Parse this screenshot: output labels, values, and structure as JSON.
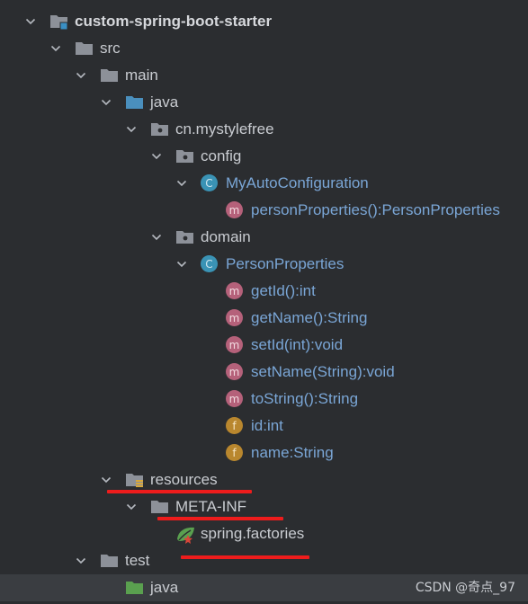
{
  "tree": {
    "nodes": [
      {
        "label": "custom-spring-boot-starter",
        "icon": "module-folder-icon"
      },
      {
        "label": "src",
        "icon": "folder-icon"
      },
      {
        "label": "main",
        "icon": "folder-icon"
      },
      {
        "label": "java",
        "icon": "source-root-folder-icon"
      },
      {
        "label": "cn.mystylefree",
        "icon": "package-icon"
      },
      {
        "label": "config",
        "icon": "package-icon"
      },
      {
        "label": "MyAutoConfiguration",
        "icon": "class-icon",
        "badge": "C"
      },
      {
        "label": "personProperties():PersonProperties",
        "icon": "method-icon",
        "badge": "m"
      },
      {
        "label": "domain",
        "icon": "package-icon"
      },
      {
        "label": "PersonProperties",
        "icon": "class-icon",
        "badge": "C"
      },
      {
        "label": "getId():int",
        "icon": "method-icon",
        "badge": "m"
      },
      {
        "label": "getName():String",
        "icon": "method-icon",
        "badge": "m"
      },
      {
        "label": "setId(int):void",
        "icon": "method-icon",
        "badge": "m"
      },
      {
        "label": "setName(String):void",
        "icon": "method-icon",
        "badge": "m"
      },
      {
        "label": "toString():String",
        "icon": "method-icon",
        "badge": "m"
      },
      {
        "label": "id:int",
        "icon": "field-icon",
        "badge": "f"
      },
      {
        "label": "name:String",
        "icon": "field-icon",
        "badge": "f"
      },
      {
        "label": "resources",
        "icon": "resources-folder-icon"
      },
      {
        "label": "META-INF",
        "icon": "folder-icon"
      },
      {
        "label": "spring.factories",
        "icon": "spring-leaf-icon"
      },
      {
        "label": "test",
        "icon": "folder-icon"
      },
      {
        "label": "java",
        "icon": "test-source-folder-icon"
      }
    ]
  },
  "watermark": "CSDN @奇点_97",
  "colors": {
    "background": "#2b2d30",
    "text": "#c9ccd1",
    "class_text": "#7aa6d6",
    "class_badge": "#3a93b5",
    "method_badge": "#b5617a",
    "field_badge": "#b9872e",
    "source_folder": "#4a8fbd",
    "test_folder": "#5aa04f",
    "underline": "#ee1c1c"
  }
}
